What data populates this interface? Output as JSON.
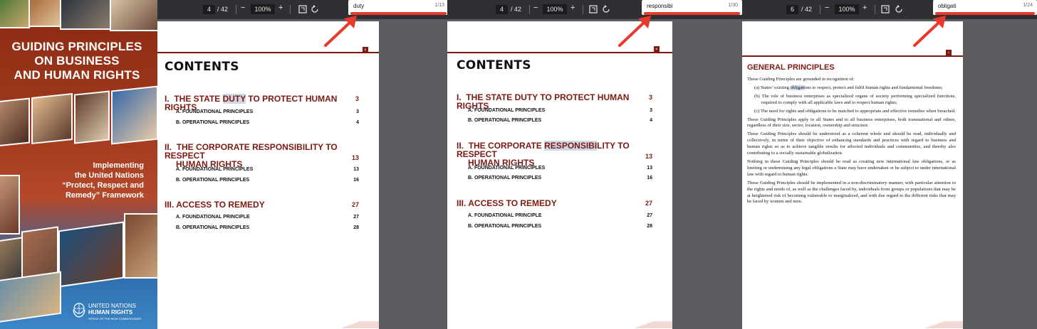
{
  "cover": {
    "title_lines": [
      "GUIDING PRINCIPLES",
      "ON BUSINESS",
      "AND HUMAN RIGHTS"
    ],
    "subtitle_lines": [
      "Implementing",
      "the United Nations",
      "“Protect, Respect and",
      "Remedy” Framework"
    ],
    "logo_lines": [
      "UNITED NATIONS",
      "HUMAN RIGHTS",
      "OFFICE OF THE HIGH COMMISSIONER"
    ]
  },
  "viewers": [
    {
      "page_current": "4",
      "page_total": "/ 42",
      "zoom": "100%",
      "zoom_out": "−",
      "zoom_in": "+",
      "search": {
        "query": "duty",
        "count": "1/13"
      },
      "page_tag": "iii",
      "heading": "CONTENTS",
      "sections": [
        {
          "roman": "I.",
          "before": "THE STATE ",
          "hl": "DUTY",
          "after": " TO PROTECT HUMAN RIGHTS",
          "page": "3",
          "subs": [
            {
              "label": "A.  FOUNDATIONAL PRINCIPLES",
              "page": "3"
            },
            {
              "label": "B.  OPERATIONAL PRINCIPLES",
              "page": "4"
            }
          ]
        },
        {
          "roman": "II.",
          "before": "THE CORPORATE RESPONSIBILITY TO RESPECT",
          "hl": "",
          "after": "",
          "line2": "HUMAN RIGHTS",
          "page": "13",
          "subs": [
            {
              "label": "A.  FOUNDATIONAL PRINCIPLES",
              "page": "13"
            },
            {
              "label": "B.  OPERATIONAL PRINCIPLES",
              "page": "16"
            }
          ]
        },
        {
          "roman": "III.",
          "before": "ACCESS TO REMEDY",
          "hl": "",
          "after": "",
          "page": "27",
          "subs": [
            {
              "label": "A.  FOUNDATIONAL PRINCIPLE",
              "page": "27"
            },
            {
              "label": "B.  OPERATIONAL PRINCIPLES",
              "page": "28"
            }
          ]
        }
      ]
    },
    {
      "page_current": "4",
      "page_total": "/ 42",
      "zoom": "100%",
      "zoom_out": "−",
      "zoom_in": "+",
      "search": {
        "query": "responsibi",
        "count": "1/30"
      },
      "page_tag": "iii",
      "heading": "CONTENTS",
      "sections": [
        {
          "roman": "I.",
          "before": "THE STATE DUTY TO PROTECT HUMAN RIGHTS",
          "hl": "",
          "after": "",
          "page": "3",
          "subs": [
            {
              "label": "A.  FOUNDATIONAL PRINCIPLES",
              "page": "3"
            },
            {
              "label": "B.  OPERATIONAL PRINCIPLES",
              "page": "4"
            }
          ]
        },
        {
          "roman": "II.",
          "before": "THE CORPORATE ",
          "hl": "RESPONSIBI",
          "after": "LITY TO RESPECT",
          "line2": "HUMAN RIGHTS",
          "page": "13",
          "subs": [
            {
              "label": "A.  FOUNDATIONAL PRINCIPLES",
              "page": "13"
            },
            {
              "label": "B.  OPERATIONAL PRINCIPLES",
              "page": "16"
            }
          ]
        },
        {
          "roman": "III.",
          "before": "ACCESS TO REMEDY",
          "hl": "",
          "after": "",
          "page": "27",
          "subs": [
            {
              "label": "A.  FOUNDATIONAL PRINCIPLE",
              "page": "27"
            },
            {
              "label": "B.  OPERATIONAL PRINCIPLES",
              "page": "28"
            }
          ]
        }
      ]
    },
    {
      "page_current": "6",
      "page_total": "/ 42",
      "zoom": "100%",
      "zoom_out": "−",
      "zoom_in": "+",
      "search": {
        "query": "obligati",
        "count": "1/24"
      },
      "page_tag": "1",
      "heading": "GENERAL PRINCIPLES",
      "intro": "These Guiding Principles are grounded in recognition of:",
      "list": [
        {
          "marker": "(a)",
          "before": "States’ existing ",
          "hl": "obligati",
          "after": "ons to respect, protect and fulfil human rights and fundamental freedoms;"
        },
        {
          "marker": "(b)",
          "before": "The role of business enterprises as specialized organs of society performing specialized functions, required to comply with all applicable laws and to respect human rights;",
          "hl": "",
          "after": ""
        },
        {
          "marker": "(c)",
          "before": "The need for rights and obligations to be matched to appropriate and effective remedies when breached.",
          "hl": "",
          "after": ""
        }
      ],
      "paragraphs": [
        "These Guiding Principles apply to all States and to all business enterprises, both transnational and others, regardless of their size, sector, location, ownership and structure.",
        "These Guiding Principles should be understood as a coherent whole and should be read, individually and collectively, in terms of their objective of enhancing standards and practices with regard to business and human rights so as to achieve tangible results for affected individuals and communities, and thereby also contributing to a socially sustainable globalization.",
        "Nothing in these Guiding Principles should be read as creating new international law obligations, or as limiting or undermining any legal obligations a State may have undertaken or be subject to under international law with regard to human rights.",
        "These Guiding Principles should be implemented in a non-discriminatory manner, with particular attention to the rights and needs of, as well as the challenges faced by, individuals from groups or populations that may be at heightened risk of becoming vulnerable or marginalized, and with due regard to the different risks that may be faced by women and men."
      ]
    }
  ],
  "colors": {
    "accent": "#7d1a12",
    "search_bar": "#e8392d",
    "arrow": "#e8392d",
    "highlight": "#cfd9e6"
  },
  "icons": [
    "fit-page-icon",
    "rotate-icon",
    "un-emblem-icon",
    "red-arrow-icon"
  ]
}
